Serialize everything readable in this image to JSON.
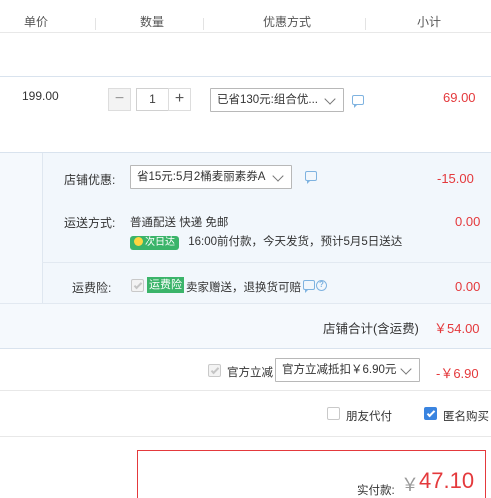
{
  "header": {
    "col_price": "单价",
    "col_qty": "数量",
    "col_promo": "优惠方式",
    "col_subtotal": "小计"
  },
  "item": {
    "price": "199.00",
    "minus": "−",
    "quantity": "1",
    "plus": "+",
    "promo_select": "已省130元:组合优...",
    "subtotal": "69.00"
  },
  "shop": {
    "discount_label": "店铺优惠:",
    "discount_select": "省15元:5月2桶麦丽素券A",
    "discount_amount": "-15.00",
    "shipping_label": "运送方式:",
    "shipping_method": "普通配送 快递 免邮",
    "next_day_badge": "次日达",
    "shipping_note": "16:00前付款，今天发货，预计5月5日送达",
    "shipping_amount": "0.00",
    "insurance_label": "运费险:",
    "insurance_badge": "运费险",
    "insurance_text": "卖家赠送，退换货可赔",
    "insurance_amount": "0.00",
    "total_label": "店铺合计(含运费)",
    "total_amount": "￥54.00"
  },
  "official": {
    "label": "官方立减",
    "select": "官方立减抵扣￥6.90元",
    "amount": "-￥6.90"
  },
  "options": {
    "friend_pay": "朋友代付",
    "anonymous": "匿名购买"
  },
  "payment": {
    "label": "实付款:",
    "currency": "￥",
    "amount": "47.10"
  },
  "colors": {
    "accent_red": "#e4393c",
    "link_blue": "#3a84e0",
    "badge_green": "#3bb46a"
  }
}
